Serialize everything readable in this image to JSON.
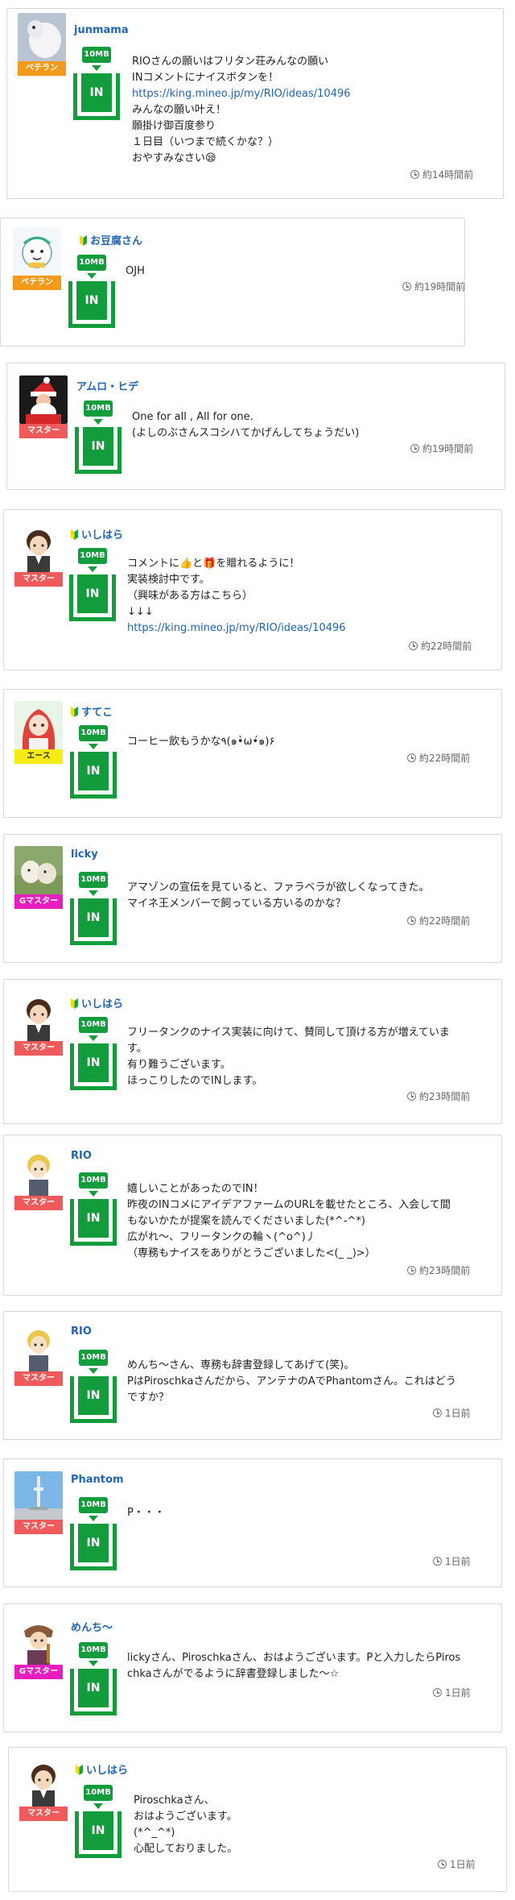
{
  "posts": [
    {
      "user": "junmama",
      "rank": "ベテラン",
      "beginner": false,
      "amount": "10MB",
      "in_label": "IN",
      "lines": [
        {
          "text": "RIOさんの願いはフリタン荘みんなの願い",
          "link": false
        },
        {
          "text": "INコメントにナイスボタンを！",
          "link": false
        },
        {
          "text": "https://king.mineo.jp/my/RIO/ideas/10496",
          "link": true
        },
        {
          "text": "みんなの願い叶え！",
          "link": false
        },
        {
          "text": "願掛け御百度参り",
          "link": false
        },
        {
          "text": "１日目（いつまで続くかな？）",
          "link": false
        },
        {
          "text": "おやすみなさい😪",
          "link": false
        }
      ],
      "time": "約14時間前"
    },
    {
      "user": "お豆腐さん",
      "rank": "ベテラン",
      "beginner": true,
      "amount": "10MB",
      "in_label": "IN",
      "lines": [
        {
          "text": "OJH",
          "link": false
        }
      ],
      "time": "約19時間前"
    },
    {
      "user": "アムロ・ヒデ",
      "rank": "マスター",
      "beginner": false,
      "amount": "10MB",
      "in_label": "IN",
      "lines": [
        {
          "text": "One for all , All for one.",
          "link": false
        },
        {
          "text": "(よしのぶさんスコシハてかげんしてちょうだい)",
          "link": false
        }
      ],
      "time": "約19時間前"
    },
    {
      "user": "いしはら",
      "rank": "マスター",
      "beginner": true,
      "amount": "10MB",
      "in_label": "IN",
      "lines": [
        {
          "text": "コメントに👍と🎁を贈れるように！",
          "link": false
        },
        {
          "text": "実装検討中です。",
          "link": false
        },
        {
          "text": "（興味がある方はこちら）",
          "link": false
        },
        {
          "text": "↓↓↓",
          "link": false
        },
        {
          "text": "https://king.mineo.jp/my/RIO/ideas/10496",
          "link": true
        }
      ],
      "time": "約22時間前"
    },
    {
      "user": "すてこ",
      "rank": "エース",
      "beginner": true,
      "amount": "10MB",
      "in_label": "IN",
      "lines": [
        {
          "text": "コーヒー飲もうかな٩(๑•̀ω•́๑)۶",
          "link": false
        }
      ],
      "time": "約22時間前"
    },
    {
      "user": "licky",
      "rank": "Gマスター",
      "beginner": false,
      "amount": "10MB",
      "in_label": "IN",
      "lines": [
        {
          "text": "アマゾンの宣伝を見ていると、ファラベラが欲しくなってきた。",
          "link": false
        },
        {
          "text": "マイネ王メンバーで飼っている方いるのかな？",
          "link": false
        }
      ],
      "time": "約22時間前"
    },
    {
      "user": "いしはら",
      "rank": "マスター",
      "beginner": true,
      "amount": "10MB",
      "in_label": "IN",
      "lines": [
        {
          "text": "フリータンクのナイス実装に向けて、賛同して頂ける方が増えていま",
          "link": false
        },
        {
          "text": "す。",
          "link": false
        },
        {
          "text": "有り難うございます。",
          "link": false
        },
        {
          "text": "ほっこりしたのでINします。",
          "link": false
        }
      ],
      "time": "約23時間前"
    },
    {
      "user": "RIO",
      "rank": "マスター",
      "beginner": false,
      "amount": "10MB",
      "in_label": "IN",
      "lines": [
        {
          "text": "嬉しいことがあったのでIN！",
          "link": false
        },
        {
          "text": "昨夜のINコメにアイデアファームのURLを載せたところ、入会して間",
          "link": false
        },
        {
          "text": "もないかたが提案を読んでくださいました(*^-^*)",
          "link": false
        },
        {
          "text": "広がれ〜、フリータンクの輪ヽ(^o^)丿",
          "link": false
        },
        {
          "text": "（専務もナイスをありがとうございました<(_ _)>）",
          "link": false
        }
      ],
      "time": "約23時間前"
    },
    {
      "user": "RIO",
      "rank": "マスター",
      "beginner": false,
      "amount": "10MB",
      "in_label": "IN",
      "lines": [
        {
          "text": "めんち〜さん、専務も辞書登録してあげて(笑)。",
          "link": false
        },
        {
          "text": "PはPiroschkaさんだから、アンテナのAでPhantomさん。これはどう",
          "link": false
        },
        {
          "text": "ですか？",
          "link": false
        }
      ],
      "time": "1日前"
    },
    {
      "user": "Phantom",
      "rank": "マスター",
      "beginner": false,
      "amount": "10MB",
      "in_label": "IN",
      "lines": [
        {
          "text": "P・・・",
          "link": false
        }
      ],
      "time": "1日前"
    },
    {
      "user": "めんち〜",
      "rank": "Gマスター",
      "beginner": false,
      "amount": "10MB",
      "in_label": "IN",
      "lines": [
        {
          "text": "lickyさん、Piroschkaさん、おはようございます。Pと入力したらPiros",
          "link": false
        },
        {
          "text": "chkaさんがでるように辞書登録しました〜☆",
          "link": false
        }
      ],
      "time": "1日前"
    },
    {
      "user": "いしはら",
      "rank": "マスター",
      "beginner": true,
      "amount": "10MB",
      "in_label": "IN",
      "lines": [
        {
          "text": "Piroschkaさん、",
          "link": false
        },
        {
          "text": "おはようございます。",
          "link": false
        },
        {
          "text": "(*^_^*)",
          "link": false
        },
        {
          "text": "心配しておりました。",
          "link": false
        }
      ],
      "time": "1日前"
    }
  ]
}
